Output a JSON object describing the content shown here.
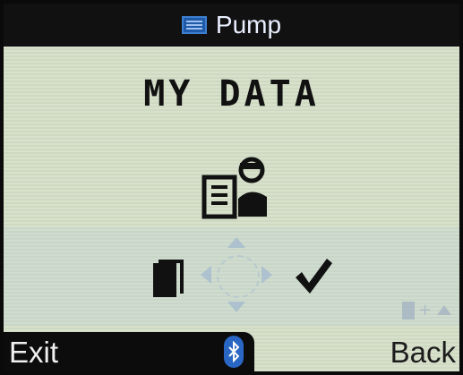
{
  "header": {
    "title": "Pump",
    "icon": "pump-icon"
  },
  "main": {
    "title": "MY DATA",
    "icon": "my-data-icon"
  },
  "navigation": {
    "left_icon": "document-icon",
    "right_icon": "checkmark-icon",
    "dpad_icon": "dpad-icon",
    "hint_text": "+",
    "hint_icons": [
      "document-icon",
      "up-arrow-icon"
    ]
  },
  "footer": {
    "left_label": "Exit",
    "right_label": "Back",
    "status_icon": "bluetooth-icon"
  },
  "colors": {
    "screen_bg": "#d8e1cc",
    "bar": "#111111",
    "accent_blue": "#2a66c4"
  }
}
